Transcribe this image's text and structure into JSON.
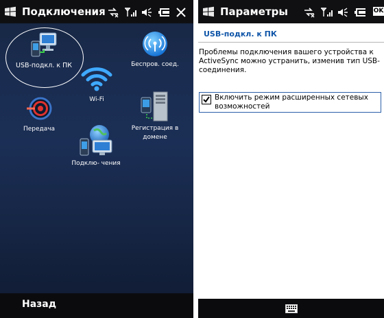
{
  "left_screen": {
    "title": "Подключения",
    "softkey_left": "Назад",
    "tiles": [
      {
        "label": "USB-подкл. к ПК",
        "icon": "usb-pc-connection-icon",
        "highlighted": true
      },
      {
        "label": "Беспров. соед.",
        "icon": "wireless-antenna-icon"
      },
      {
        "label": "Wi-Fi",
        "icon": "wifi-icon"
      },
      {
        "label": "Передача",
        "icon": "beam-transfer-icon"
      },
      {
        "label": "Регистрация в домене",
        "icon": "domain-enroll-icon"
      },
      {
        "label": "Подклю- чения",
        "icon": "connections-globe-icon"
      }
    ]
  },
  "right_screen": {
    "title": "Параметры",
    "ok_label": "OK",
    "heading": "USB-подкл. к ПК",
    "description": "Проблемы подключения вашего устройства к ActiveSync можно устранить, изменив тип USB-соединения.",
    "checkbox": {
      "label": "Включить режим расширенных сетевых возможностей",
      "checked": true
    },
    "softkey_center": "keyboard-icon"
  },
  "status_icons": [
    "data-connection-icon",
    "signal-strength-icon",
    "volume-icon",
    "battery-icon"
  ],
  "colors": {
    "left_bg": "#1b2e55",
    "topbar_bg": "#0f0f12",
    "heading_blue": "#0f55a8",
    "wifi_blue": "#3fa9ff"
  }
}
